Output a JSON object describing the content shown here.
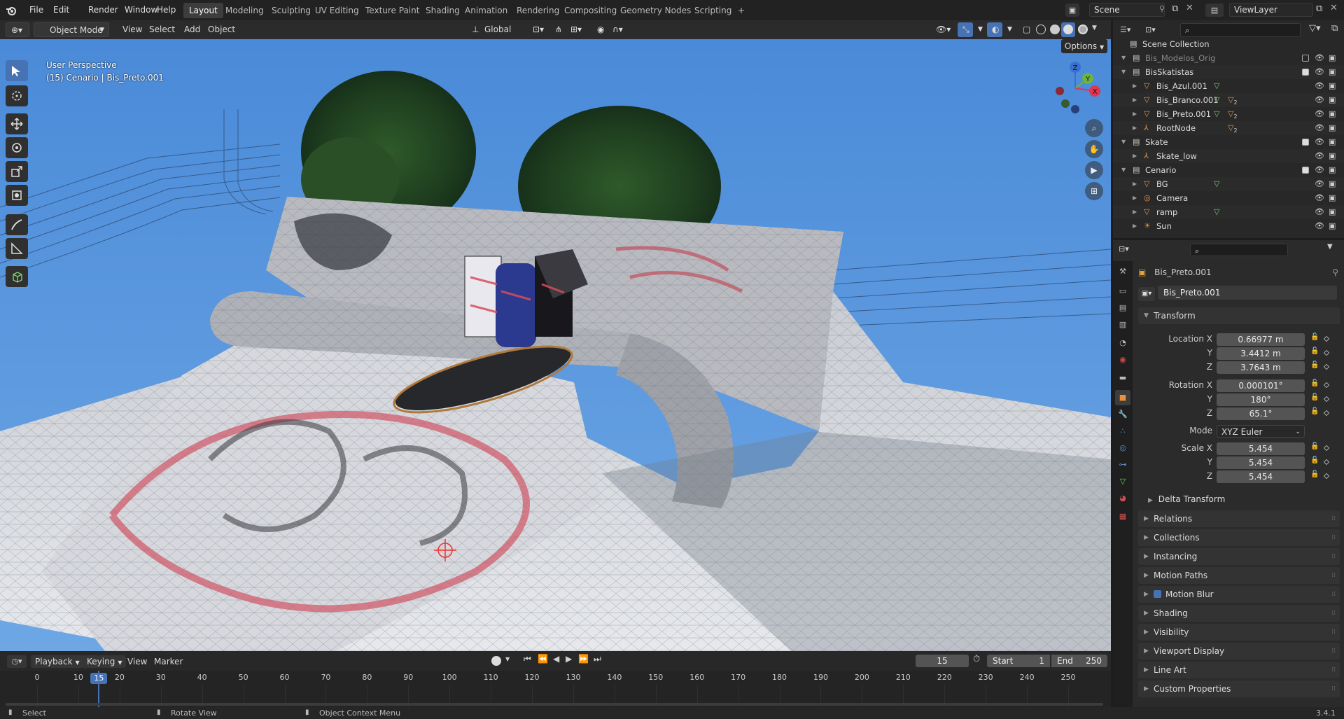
{
  "topbar": {
    "menus": [
      "File",
      "Edit",
      "Render",
      "Window",
      "Help"
    ],
    "workspaces": [
      "Layout",
      "Modeling",
      "Sculpting",
      "UV Editing",
      "Texture Paint",
      "Shading",
      "Animation",
      "Rendering",
      "Compositing",
      "Geometry Nodes",
      "Scripting"
    ],
    "add_tab": "+",
    "scene": "Scene",
    "view_layer": "ViewLayer"
  },
  "viewport_header": {
    "mode": "Object Mode",
    "menus": [
      "View",
      "Select",
      "Add",
      "Object"
    ],
    "transform_orientation": "Global",
    "options": "Options"
  },
  "viewport": {
    "perspective": "User Perspective",
    "object_info": "(15) Cenario | Bis_Preto.001",
    "gizmo": {
      "z": "Z",
      "y": "Y",
      "x": "X"
    }
  },
  "timeline": {
    "menus": [
      "Playback",
      "Keying",
      "View",
      "Marker"
    ],
    "current_frame": "15",
    "start_label": "Start",
    "start": "1",
    "end_label": "End",
    "end": "250",
    "ticks": [
      "0",
      "10",
      "15",
      "20",
      "30",
      "40",
      "50",
      "60",
      "70",
      "80",
      "90",
      "100",
      "110",
      "120",
      "130",
      "140",
      "150",
      "160",
      "170",
      "180",
      "190",
      "200",
      "210",
      "220",
      "230",
      "240",
      "250"
    ],
    "current_fraction": 0.06
  },
  "statusbar": {
    "items": [
      "Select",
      "Rotate View",
      "Object Context Menu"
    ],
    "version": "3.4.1"
  },
  "outliner": {
    "root": "Scene Collection",
    "rows": [
      {
        "name": "Bis_Modelos_Orig",
        "depth": 1,
        "type": "collection",
        "dim": true
      },
      {
        "name": "BisSkatistas",
        "depth": 1,
        "type": "collection"
      },
      {
        "name": "Bis_Azul.001",
        "depth": 2,
        "type": "mesh"
      },
      {
        "name": "Bis_Branco.001",
        "depth": 2,
        "type": "mesh",
        "count": "2"
      },
      {
        "name": "Bis_Preto.001",
        "depth": 2,
        "type": "mesh",
        "count": "2"
      },
      {
        "name": "RootNode",
        "depth": 2,
        "type": "empty",
        "count": "2"
      },
      {
        "name": "Skate",
        "depth": 1,
        "type": "collection"
      },
      {
        "name": "Skate_low",
        "depth": 2,
        "type": "empty"
      },
      {
        "name": "Cenario",
        "depth": 1,
        "type": "collection"
      },
      {
        "name": "BG",
        "depth": 2,
        "type": "mesh"
      },
      {
        "name": "Camera",
        "depth": 2,
        "type": "camera"
      },
      {
        "name": "ramp",
        "depth": 2,
        "type": "mesh"
      },
      {
        "name": "Sun",
        "depth": 2,
        "type": "light"
      }
    ]
  },
  "properties": {
    "object_name": "Bis_Preto.001",
    "datablock": "Bis_Preto.001",
    "transform_title": "Transform",
    "location": {
      "label": "Location X",
      "x": "0.66977 m",
      "y": "3.4412 m",
      "z": "3.7643 m"
    },
    "rotation": {
      "label": "Rotation X",
      "x": "0.000101°",
      "y": "180°",
      "z": "65.1°"
    },
    "mode_label": "Mode",
    "mode": "XYZ Euler",
    "scale": {
      "label": "Scale X",
      "x": "5.454",
      "y": "5.454",
      "z": "5.454"
    },
    "axis_y": "Y",
    "axis_z": "Z",
    "delta": "Delta Transform",
    "panels": [
      "Relations",
      "Collections",
      "Instancing",
      "Motion Paths",
      "Motion Blur",
      "Shading",
      "Visibility",
      "Viewport Display",
      "Line Art",
      "Custom Properties"
    ]
  },
  "colors": {
    "accent": "#4772b3",
    "sky": "#5b9be0",
    "active_tab": "#3d3d3d"
  }
}
